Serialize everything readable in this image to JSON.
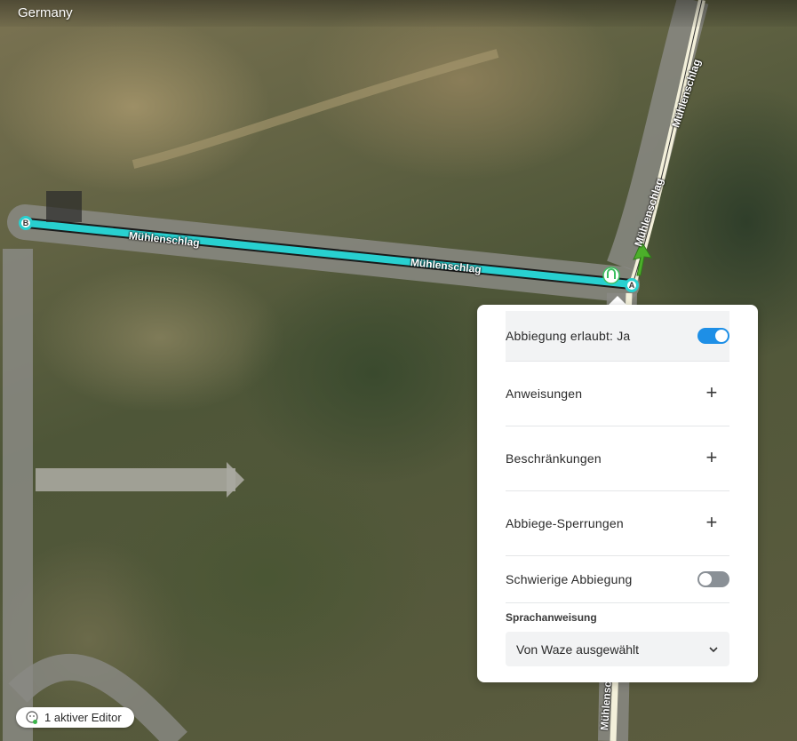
{
  "map": {
    "country": "Germany",
    "road_labels": {
      "main_1": "Mühlenschlag",
      "main_2": "Mühlenschlag",
      "side_1": "Mühlenschlag",
      "side_2": "Mühlenschlag",
      "side_3": "Mühlenschlag"
    },
    "node_a": "A",
    "node_b": "B",
    "accent_color": "#28d0d0"
  },
  "panel": {
    "turn_allowed_label": "Abbiegung erlaubt: Ja",
    "turn_allowed": true,
    "instructions_label": "Anweisungen",
    "restrictions_label": "Beschränkungen",
    "turn_closures_label": "Abbiege-Sperrungen",
    "difficult_turn_label": "Schwierige Abbiegung",
    "difficult_turn": false,
    "voice_section_title": "Sprachanweisung",
    "voice_selected": "Von Waze ausgewählt"
  },
  "footer": {
    "editor_count_label": "1 aktiver Editor"
  },
  "colors": {
    "toggle_on": "#1e8fe6",
    "toggle_off": "#8a9096",
    "turn_arrow": "#4caf2a"
  }
}
